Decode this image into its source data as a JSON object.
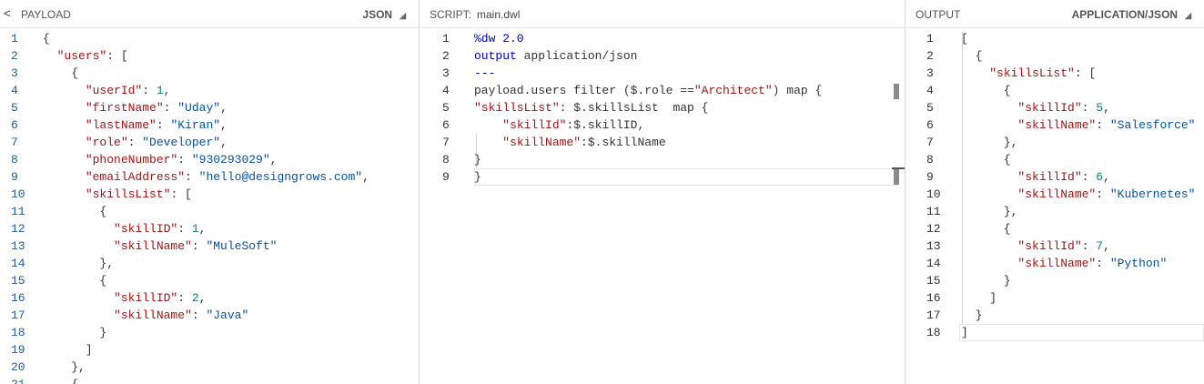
{
  "payload": {
    "collapse_icon": "chevron-left-icon",
    "title": "PAYLOAD",
    "format": "JSON",
    "lines": [
      [
        [
          "p",
          "{"
        ]
      ],
      [
        [
          "p",
          "  "
        ],
        [
          "k",
          "\"users\""
        ],
        [
          "p",
          ": ["
        ]
      ],
      [
        [
          "p",
          "    {"
        ]
      ],
      [
        [
          "p",
          "      "
        ],
        [
          "k",
          "\"userId\""
        ],
        [
          "p",
          ": "
        ],
        [
          "n",
          "1"
        ],
        [
          "p",
          ","
        ]
      ],
      [
        [
          "p",
          "      "
        ],
        [
          "k",
          "\"firstName\""
        ],
        [
          "p",
          ": "
        ],
        [
          "s",
          "\"Uday\""
        ],
        [
          "p",
          ","
        ]
      ],
      [
        [
          "p",
          "      "
        ],
        [
          "k",
          "\"lastName\""
        ],
        [
          "p",
          ": "
        ],
        [
          "s",
          "\"Kiran\""
        ],
        [
          "p",
          ","
        ]
      ],
      [
        [
          "p",
          "      "
        ],
        [
          "k",
          "\"role\""
        ],
        [
          "p",
          ": "
        ],
        [
          "s",
          "\"Developer\""
        ],
        [
          "p",
          ","
        ]
      ],
      [
        [
          "p",
          "      "
        ],
        [
          "k",
          "\"phoneNumber\""
        ],
        [
          "p",
          ": "
        ],
        [
          "s",
          "\"930293029\""
        ],
        [
          "p",
          ","
        ]
      ],
      [
        [
          "p",
          "      "
        ],
        [
          "k",
          "\"emailAddress\""
        ],
        [
          "p",
          ": "
        ],
        [
          "s",
          "\"hello@designgrows.com\""
        ],
        [
          "p",
          ","
        ]
      ],
      [
        [
          "p",
          "      "
        ],
        [
          "k",
          "\"skillsList\""
        ],
        [
          "p",
          ": ["
        ]
      ],
      [
        [
          "p",
          "        {"
        ]
      ],
      [
        [
          "p",
          "          "
        ],
        [
          "k",
          "\"skillID\""
        ],
        [
          "p",
          ": "
        ],
        [
          "n",
          "1"
        ],
        [
          "p",
          ","
        ]
      ],
      [
        [
          "p",
          "          "
        ],
        [
          "k",
          "\"skillName\""
        ],
        [
          "p",
          ": "
        ],
        [
          "s",
          "\"MuleSoft\""
        ]
      ],
      [
        [
          "p",
          "        },"
        ]
      ],
      [
        [
          "p",
          "        {"
        ]
      ],
      [
        [
          "p",
          "          "
        ],
        [
          "k",
          "\"skillID\""
        ],
        [
          "p",
          ": "
        ],
        [
          "n",
          "2"
        ],
        [
          "p",
          ","
        ]
      ],
      [
        [
          "p",
          "          "
        ],
        [
          "k",
          "\"skillName\""
        ],
        [
          "p",
          ": "
        ],
        [
          "s",
          "\"Java\""
        ]
      ],
      [
        [
          "p",
          "        }"
        ]
      ],
      [
        [
          "p",
          "      ]"
        ]
      ],
      [
        [
          "p",
          "    },"
        ]
      ],
      [
        [
          "p",
          "    {"
        ]
      ]
    ]
  },
  "script": {
    "label": "SCRIPT:",
    "filename": "main.dwl",
    "lines": [
      [
        [
          "dir",
          "%dw 2.0"
        ]
      ],
      [
        [
          "kw",
          "output"
        ],
        [
          "p",
          " application/json"
        ]
      ],
      [
        [
          "kw",
          "---"
        ]
      ],
      [
        [
          "p",
          "payload.users filter ($.role =="
        ],
        [
          "k",
          "\"Architect\""
        ],
        [
          "p",
          ") map {"
        ]
      ],
      [
        [
          "k",
          "\"skillsList\""
        ],
        [
          "p",
          ": $.skillsList  map {"
        ]
      ],
      [
        [
          "p",
          "    "
        ],
        [
          "k",
          "\"skillId\""
        ],
        [
          "p",
          ":$.skillID,"
        ]
      ],
      [
        [
          "p",
          "    "
        ],
        [
          "k",
          "\"skillName\""
        ],
        [
          "p",
          ":$.skillName"
        ]
      ],
      [
        [
          "p",
          "}"
        ]
      ],
      [
        [
          "p",
          "}"
        ]
      ]
    ]
  },
  "output": {
    "title": "OUTPUT",
    "format": "APPLICATION/JSON",
    "lines": [
      [
        [
          "p",
          "["
        ]
      ],
      [
        [
          "p",
          "  {"
        ]
      ],
      [
        [
          "p",
          "    "
        ],
        [
          "k",
          "\"skillsList\""
        ],
        [
          "p",
          ": ["
        ]
      ],
      [
        [
          "p",
          "      {"
        ]
      ],
      [
        [
          "p",
          "        "
        ],
        [
          "k",
          "\"skillId\""
        ],
        [
          "p",
          ": "
        ],
        [
          "n",
          "5"
        ],
        [
          "p",
          ","
        ]
      ],
      [
        [
          "p",
          "        "
        ],
        [
          "k",
          "\"skillName\""
        ],
        [
          "p",
          ": "
        ],
        [
          "s",
          "\"Salesforce\""
        ]
      ],
      [
        [
          "p",
          "      },"
        ]
      ],
      [
        [
          "p",
          "      {"
        ]
      ],
      [
        [
          "p",
          "        "
        ],
        [
          "k",
          "\"skillId\""
        ],
        [
          "p",
          ": "
        ],
        [
          "n",
          "6"
        ],
        [
          "p",
          ","
        ]
      ],
      [
        [
          "p",
          "        "
        ],
        [
          "k",
          "\"skillName\""
        ],
        [
          "p",
          ": "
        ],
        [
          "s",
          "\"Kubernetes\""
        ]
      ],
      [
        [
          "p",
          "      },"
        ]
      ],
      [
        [
          "p",
          "      {"
        ]
      ],
      [
        [
          "p",
          "        "
        ],
        [
          "k",
          "\"skillId\""
        ],
        [
          "p",
          ": "
        ],
        [
          "n",
          "7"
        ],
        [
          "p",
          ","
        ]
      ],
      [
        [
          "p",
          "        "
        ],
        [
          "k",
          "\"skillName\""
        ],
        [
          "p",
          ": "
        ],
        [
          "s",
          "\"Python\""
        ]
      ],
      [
        [
          "p",
          "      }"
        ]
      ],
      [
        [
          "p",
          "    ]"
        ]
      ],
      [
        [
          "p",
          "  }"
        ]
      ],
      [
        [
          "p",
          "]"
        ]
      ]
    ]
  },
  "dropdown_icon": "triangle-down-icon"
}
